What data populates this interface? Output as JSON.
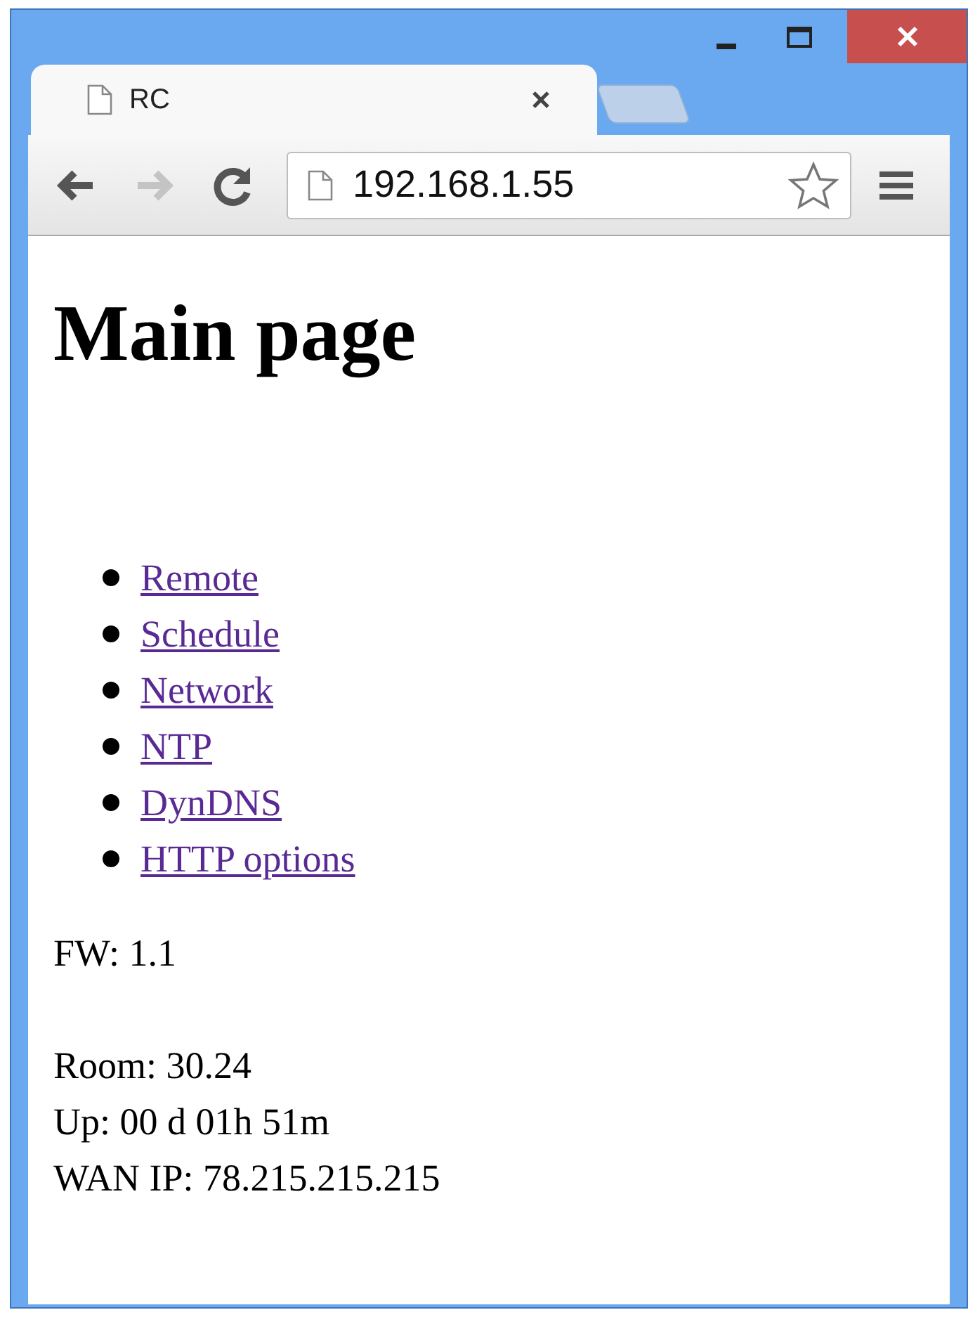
{
  "window": {
    "controls": [
      {
        "kind": "minimize"
      },
      {
        "kind": "maximize"
      },
      {
        "kind": "close"
      }
    ]
  },
  "tabs": [
    {
      "title": "RC",
      "selected": true
    }
  ],
  "toolbar": {
    "back_disabled": false,
    "forward_disabled": true,
    "address": "192.168.1.55",
    "bookmarked": false
  },
  "page": {
    "heading": "Main page",
    "links": [
      {
        "label": "Remote"
      },
      {
        "label": "Schedule"
      },
      {
        "label": "Network"
      },
      {
        "label": "NTP"
      },
      {
        "label": "DynDNS"
      },
      {
        "label": "HTTP options"
      }
    ],
    "firmware": "FW: 1.1",
    "status_lines": [
      "Room: 30.24",
      "Up: 00 d 01h 51m",
      "WAN IP: 78.215.215.215"
    ]
  }
}
